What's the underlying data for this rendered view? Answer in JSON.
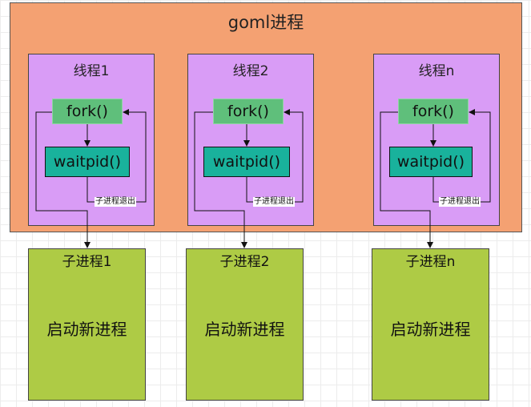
{
  "process": {
    "title": "goml进程"
  },
  "threads": [
    {
      "title": "线程1",
      "fork": "fork()",
      "waitpid": "waitpid()",
      "exit_label": "子进程退出"
    },
    {
      "title": "线程2",
      "fork": "fork()",
      "waitpid": "waitpid()",
      "exit_label": "子进程退出"
    },
    {
      "title": "线程n",
      "fork": "fork()",
      "waitpid": "waitpid()",
      "exit_label": "子进程退出"
    }
  ],
  "children": [
    {
      "title": "子进程1",
      "body": "启动新进程"
    },
    {
      "title": "子进程2",
      "body": "启动新进程"
    },
    {
      "title": "子进程n",
      "body": "启动新进程"
    }
  ],
  "colors": {
    "process_bg": "#f4a172",
    "thread_bg": "#d99cf6",
    "fork_bg": "#5fbf7b",
    "waitpid_bg": "#19b29c",
    "child_bg": "#aecb45"
  }
}
